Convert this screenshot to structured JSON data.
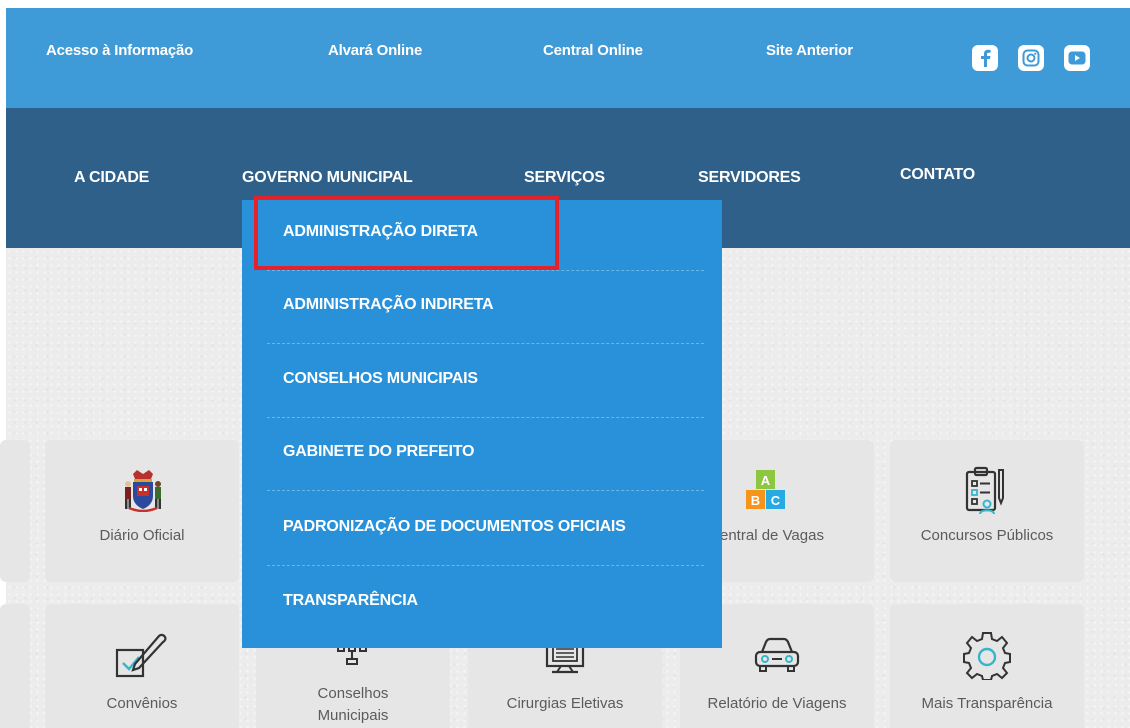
{
  "topbar": {
    "links": [
      "Acesso à Informação",
      "Alvará Online",
      "Central Online",
      "Site Anterior"
    ],
    "social": [
      "facebook-icon",
      "instagram-icon",
      "youtube-icon"
    ]
  },
  "nav": {
    "items": [
      "A CIDADE",
      "GOVERNO MUNICIPAL",
      "SERVIÇOS",
      "SERVIDORES",
      "CONTATO"
    ]
  },
  "dropdown": {
    "items": [
      "ADMINISTRAÇÃO DIRETA",
      "ADMINISTRAÇÃO INDIRETA",
      "CONSELHOS MUNICIPAIS",
      "GABINETE DO PREFEITO",
      "PADRONIZAÇÃO DE DOCUMENTOS OFICIAIS",
      "TRANSPARÊNCIA"
    ],
    "highlighted_index": 0
  },
  "cards": {
    "row1": [
      {
        "label": "Diário Oficial",
        "icon": "coat-of-arms-icon"
      },
      {
        "label": "entral de Vagas",
        "icon": "abc-blocks-icon"
      },
      {
        "label": "Concursos Públicos",
        "icon": "clipboard-icon"
      }
    ],
    "row2": [
      {
        "label": "Convênios",
        "icon": "pen-check-icon"
      },
      {
        "label": "Conselhos Municipais",
        "label_line1": "Conselhos",
        "label_line2": "Municipais",
        "icon": "org-chart-icon"
      },
      {
        "label": "Cirurgias Eletivas",
        "icon": "monitor-icon"
      },
      {
        "label": "Relatório de Viagens",
        "icon": "car-icon"
      },
      {
        "label": "Mais Transparência",
        "icon": "gear-icon"
      }
    ]
  },
  "colors": {
    "topbar": "#3f9ad8",
    "nav": "#2e6089",
    "dropdown": "#2991d9",
    "highlight": "#e3222b",
    "icon_teal": "#36b6c9"
  }
}
